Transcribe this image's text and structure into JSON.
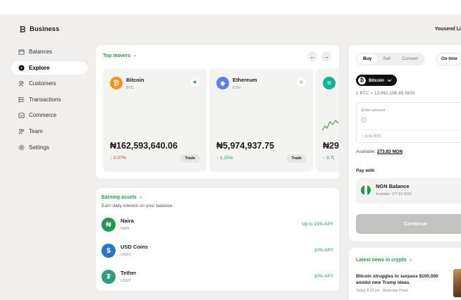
{
  "brand": {
    "name": "Business",
    "icon": "business-logo-icon"
  },
  "user": {
    "name": "Yousend Li"
  },
  "sidebar": {
    "items": [
      {
        "label": "Balances",
        "icon": "wallet-icon",
        "active": false
      },
      {
        "label": "Explore",
        "icon": "compass-icon",
        "active": true
      },
      {
        "label": "Customers",
        "icon": "users-icon",
        "active": false
      },
      {
        "label": "Transactions",
        "icon": "list-icon",
        "active": false
      },
      {
        "label": "Commerce",
        "icon": "store-icon",
        "active": false
      },
      {
        "label": "Team",
        "icon": "team-icon",
        "active": false
      },
      {
        "label": "Settings",
        "icon": "gear-icon",
        "active": false
      }
    ]
  },
  "top_movers": {
    "title": "Top movers",
    "chevron": "›",
    "prev": "←",
    "next": "→",
    "coins": [
      {
        "name": "Bitcoin",
        "symbol": "BTC",
        "logo": "₿",
        "color": "#f7931a",
        "starred": true,
        "price": "₦162,593,640.06",
        "change": "↓ 0.07%",
        "direction": "down",
        "action": "Trade"
      },
      {
        "name": "Ethereum",
        "symbol": "ETH",
        "logo": "◆",
        "color": "#627eea",
        "starred": false,
        "price": "₦5,974,937.75",
        "change": "↑ 1.25%",
        "direction": "up",
        "action": "Trade"
      },
      {
        "name": "",
        "symbol": "",
        "logo": "≡",
        "color": "#10b597",
        "starred": false,
        "price": "₦29",
        "change": "↑ 3.7(",
        "direction": "up",
        "action": ""
      }
    ]
  },
  "earning": {
    "title": "Earning assets",
    "chevron": "›",
    "subtitle": "Earn daily interest on your balance.",
    "assets": [
      {
        "name": "Naira",
        "code": "NGN",
        "logo": "₦",
        "color": "#1e9a4a",
        "apy": "Up to 15% APY"
      },
      {
        "name": "USD Coins",
        "code": "USDC",
        "logo": "$",
        "color": "#2775ca",
        "apy": "10% APY"
      },
      {
        "name": "Tether",
        "code": "USDT",
        "logo": "₮",
        "color": "#26a17b",
        "apy": "10% APY"
      }
    ]
  },
  "trade": {
    "tabs": [
      {
        "label": "Buy",
        "active": true
      },
      {
        "label": "Sell",
        "active": false
      },
      {
        "label": "Convert",
        "active": false
      }
    ],
    "frequency": "On-time",
    "coin_select": {
      "label": "Bitcoin",
      "icon": "bitcoin-icon"
    },
    "rate": "1 BTC = 13,882,186.46 NGN",
    "amount": {
      "label": "Enter amount",
      "value": "0",
      "btc_equiv": "~ 0.00 BTC"
    },
    "available_label": "Available:",
    "available_value": "273.83 NGN",
    "pay_with": "Pay with",
    "pay_option": {
      "name": "NGN Balance",
      "available": "Available: 277.83 NGN",
      "icon": "nigeria-flag-icon"
    },
    "continue_label": "Continue"
  },
  "news": {
    "title": "Latest news in crypto",
    "chevron": "›",
    "headline": "Bitcoin struggles to surpass $100,000 amidst new Trump ideas.",
    "meta": "Today, 6:02 pm · Associate Press"
  },
  "colors": {
    "accent": "#1e9a4a",
    "down": "#d9362b",
    "up": "#1e9a4a",
    "background": "#f0efed"
  }
}
